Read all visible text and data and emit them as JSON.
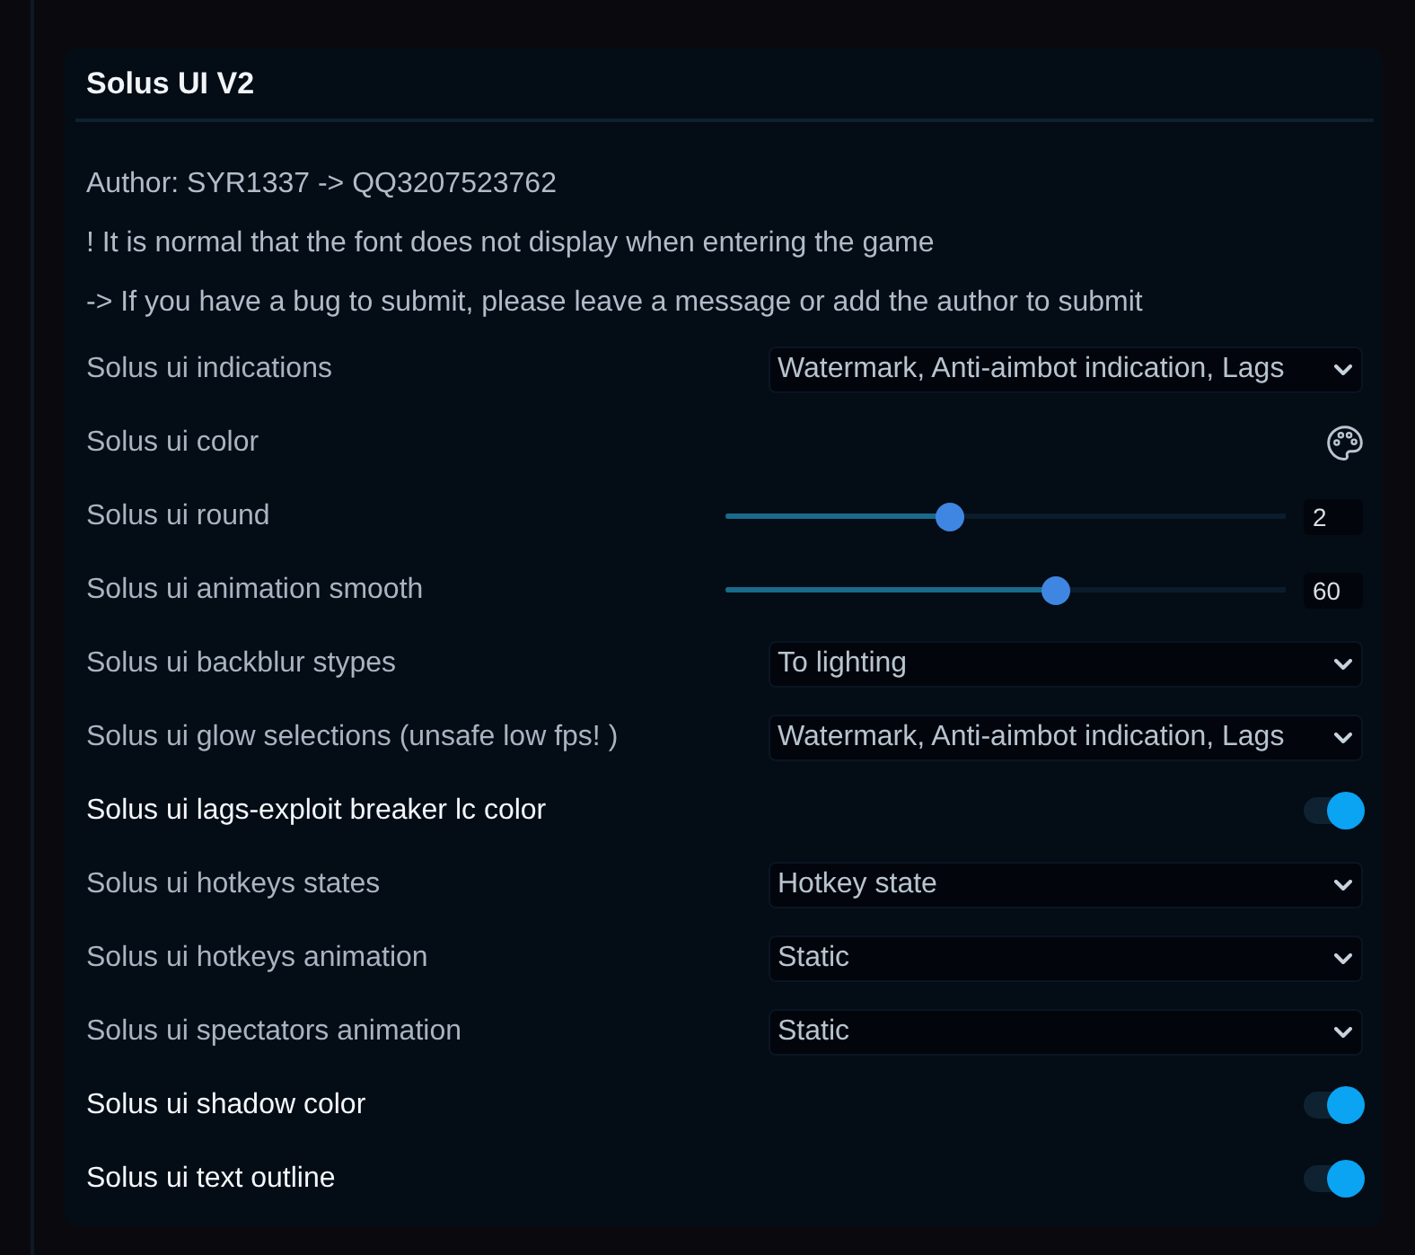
{
  "panel": {
    "title": "Solus UI V2"
  },
  "notes": [
    "Author: SYR1337 -> QQ3207523762",
    "! It is normal that the font does not display when entering the game",
    "-> If you have a bug to submit, please leave a message or add the author to submit"
  ],
  "settings": [
    {
      "kind": "select",
      "label": "Solus ui indications",
      "value": "Watermark, Anti-aimbot indication, Lags"
    },
    {
      "kind": "color",
      "label": "Solus ui color"
    },
    {
      "kind": "slider",
      "label": "Solus ui round",
      "level": 0.4,
      "reading": "2"
    },
    {
      "kind": "slider",
      "label": "Solus ui animation smooth",
      "level": 0.59,
      "reading": "60"
    },
    {
      "kind": "select",
      "label": "Solus ui backblur stypes",
      "value": "To lighting"
    },
    {
      "kind": "select",
      "label": "Solus ui glow selections (unsafe low fps! )",
      "value": "Watermark, Anti-aimbot indication, Lags"
    },
    {
      "kind": "toggle",
      "label": "Solus ui lags-exploit breaker lc color",
      "on": true
    },
    {
      "kind": "select",
      "label": "Solus ui hotkeys states",
      "value": "Hotkey state"
    },
    {
      "kind": "select",
      "label": "Solus ui hotkeys animation",
      "value": "Static"
    },
    {
      "kind": "select",
      "label": "Solus ui spectators animation",
      "value": "Static"
    },
    {
      "kind": "toggle",
      "label": "Solus ui shadow color",
      "on": true
    },
    {
      "kind": "toggle",
      "label": "Solus ui text outline",
      "on": true
    }
  ]
}
